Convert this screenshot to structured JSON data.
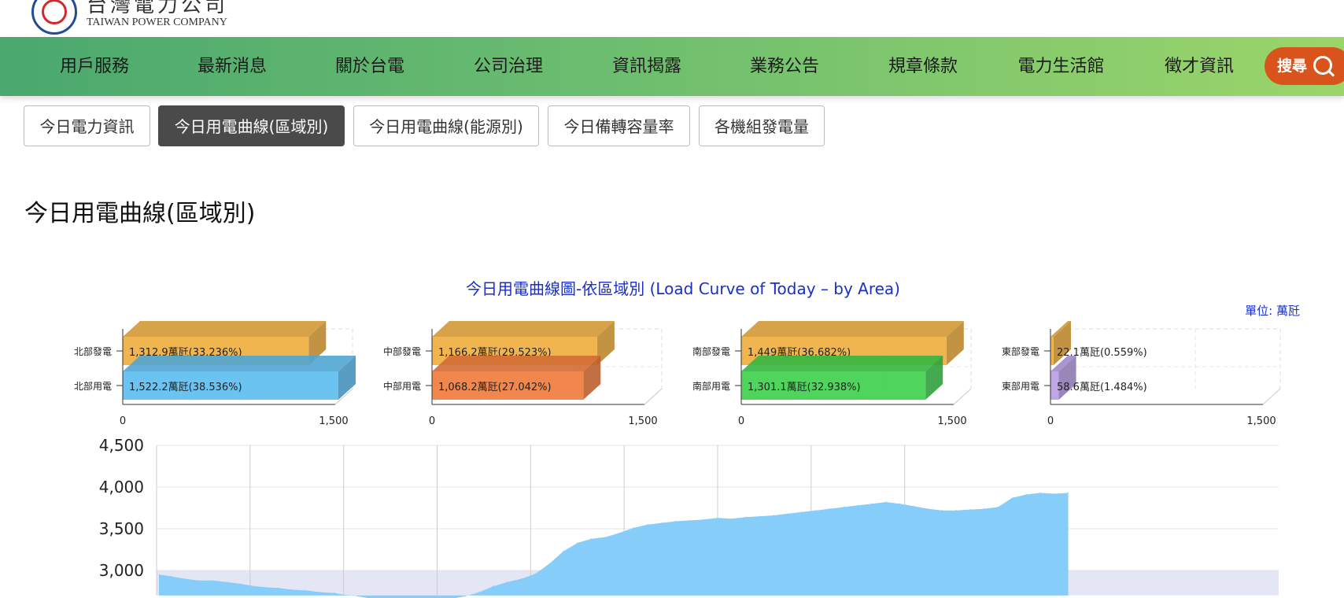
{
  "header": {
    "logo_cn": "台灣電力公司",
    "logo_en": "TAIWAN POWER COMPANY"
  },
  "nav": {
    "items": [
      "用戶服務",
      "最新消息",
      "關於台電",
      "公司治理",
      "資訊揭露",
      "業務公告",
      "規章條款",
      "電力生活館",
      "徵才資訊"
    ],
    "search_label": "搜尋"
  },
  "tabs": [
    {
      "label": "今日電力資訊",
      "active": false
    },
    {
      "label": "今日用電曲線(區域別)",
      "active": true
    },
    {
      "label": "今日用電曲線(能源別)",
      "active": false
    },
    {
      "label": "今日備轉容量率",
      "active": false
    },
    {
      "label": "各機組發電量",
      "active": false
    }
  ],
  "page_title": "今日用電曲線(區域別)",
  "colors": {
    "north_gen": "#f0ad3c",
    "north_use": "#5bbcf0",
    "central_use": "#f07a3a",
    "south_use": "#3ccf4a",
    "east_use": "#b79ce4",
    "area_fill": "#86cdfa",
    "band_fill": "#e4e6f6",
    "title_color": "#1a2fc8"
  },
  "chart_data": [
    {
      "type": "bar",
      "title": "今日用電曲線圖-依區域別 (Load Curve of Today – by Area)",
      "unit_label": "單位: 萬瓩",
      "panels": [
        {
          "bars": [
            {
              "label": "北部發電",
              "value": 1312.9,
              "text": "1,312.9萬瓩(33.236%)",
              "color_key": "north_gen"
            },
            {
              "label": "北部用電",
              "value": 1522.2,
              "text": "1,522.2萬瓩(38.536%)",
              "color_key": "north_use"
            }
          ]
        },
        {
          "bars": [
            {
              "label": "中部發電",
              "value": 1166.2,
              "text": "1,166.2萬瓩(29.523%)",
              "color_key": "north_gen"
            },
            {
              "label": "中部用電",
              "value": 1068.2,
              "text": "1,068.2萬瓩(27.042%)",
              "color_key": "central_use"
            }
          ]
        },
        {
          "bars": [
            {
              "label": "南部發電",
              "value": 1449,
              "text": "1,449萬瓩(36.682%)",
              "color_key": "north_gen"
            },
            {
              "label": "南部用電",
              "value": 1301.1,
              "text": "1,301.1萬瓩(32.938%)",
              "color_key": "south_use"
            }
          ]
        },
        {
          "bars": [
            {
              "label": "東部發電",
              "value": 22.1,
              "text": "22.1萬瓩(0.559%)",
              "color_key": "north_gen"
            },
            {
              "label": "東部用電",
              "value": 58.6,
              "text": "58.6萬瓩(1.484%)",
              "color_key": "east_use"
            }
          ]
        }
      ],
      "xlim": [
        0,
        1500
      ],
      "xticks": [
        "0",
        "1,500"
      ]
    },
    {
      "type": "area",
      "ylim": [
        2700,
        4500
      ],
      "yticks": [
        3000,
        3500,
        4000,
        4500
      ],
      "ytick_labels": [
        "3,000",
        "3,500",
        "4,000",
        "4,500"
      ],
      "xlim": [
        0,
        24
      ],
      "x_gridlines": [
        2,
        4,
        6,
        8,
        10,
        12,
        14,
        16
      ],
      "band": [
        2700,
        3000
      ],
      "series": [
        {
          "x": [
            0.05,
            0.3,
            0.6,
            0.9,
            1.2,
            1.5,
            1.8,
            2.0,
            2.3,
            2.6,
            2.9,
            3.2,
            3.5,
            3.8,
            4.0,
            4.2,
            4.5,
            4.8,
            5.2,
            5.5,
            5.8,
            6.0,
            6.3,
            6.6,
            6.9,
            7.2,
            7.5,
            7.8,
            8.1,
            8.4,
            8.7,
            9.0,
            9.3,
            9.6,
            9.9,
            10.2,
            10.5,
            10.8,
            11.1,
            11.4,
            11.7,
            12.0,
            12.3,
            12.6,
            12.9,
            13.2,
            13.5,
            13.8,
            14.1,
            14.4,
            14.7,
            15.0,
            15.3,
            15.6,
            15.9,
            16.2,
            16.5,
            16.8,
            17.1,
            17.4,
            17.7,
            18.0,
            18.3,
            18.6,
            18.9,
            19.2,
            19.5
          ],
          "values": [
            2950,
            2930,
            2900,
            2880,
            2880,
            2860,
            2840,
            2820,
            2800,
            2790,
            2770,
            2760,
            2740,
            2730,
            2710,
            2700,
            2670,
            2660,
            2650,
            2640,
            2640,
            2650,
            2660,
            2690,
            2740,
            2810,
            2860,
            2900,
            2960,
            3080,
            3230,
            3330,
            3380,
            3400,
            3450,
            3510,
            3550,
            3570,
            3590,
            3600,
            3610,
            3630,
            3620,
            3640,
            3650,
            3660,
            3680,
            3700,
            3720,
            3740,
            3760,
            3780,
            3800,
            3820,
            3800,
            3770,
            3740,
            3720,
            3720,
            3730,
            3740,
            3760,
            3870,
            3910,
            3930,
            3920,
            3930
          ]
        }
      ]
    }
  ]
}
